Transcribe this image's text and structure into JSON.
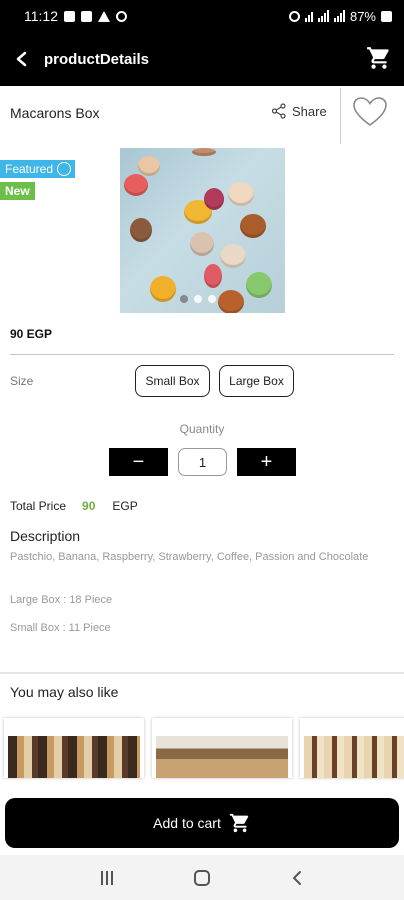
{
  "status": {
    "time": "11:12",
    "battery": "87%"
  },
  "appbar": {
    "title": "productDetails"
  },
  "product": {
    "name": "Macarons Box",
    "share_label": "Share",
    "badge_featured": "Featured",
    "badge_new": "New",
    "price": "90 EGP",
    "image_dots": 3,
    "active_dot": 0
  },
  "size": {
    "label": "Size",
    "options": [
      "Small Box",
      "Large Box"
    ]
  },
  "quantity": {
    "label": "Quantity",
    "value": "1",
    "minus": "−",
    "plus": "+"
  },
  "total": {
    "label": "Total Price",
    "value": "90",
    "currency": "EGP"
  },
  "description": {
    "title": "Description",
    "text": "Pastchio, Banana, Raspberry, Strawberry, Coffee, Passion and Chocolate",
    "large_box": "Large Box : 18 Piece",
    "small_box": "Small Box : 11 Piece"
  },
  "recommendations": {
    "title": "You may also like"
  },
  "cart_button": {
    "label": "Add to cart"
  },
  "colors": {
    "accent_green": "#6cb33f",
    "featured_blue": "#3fb6e8",
    "new_green": "#6cc04a",
    "bar_black": "#000000"
  }
}
